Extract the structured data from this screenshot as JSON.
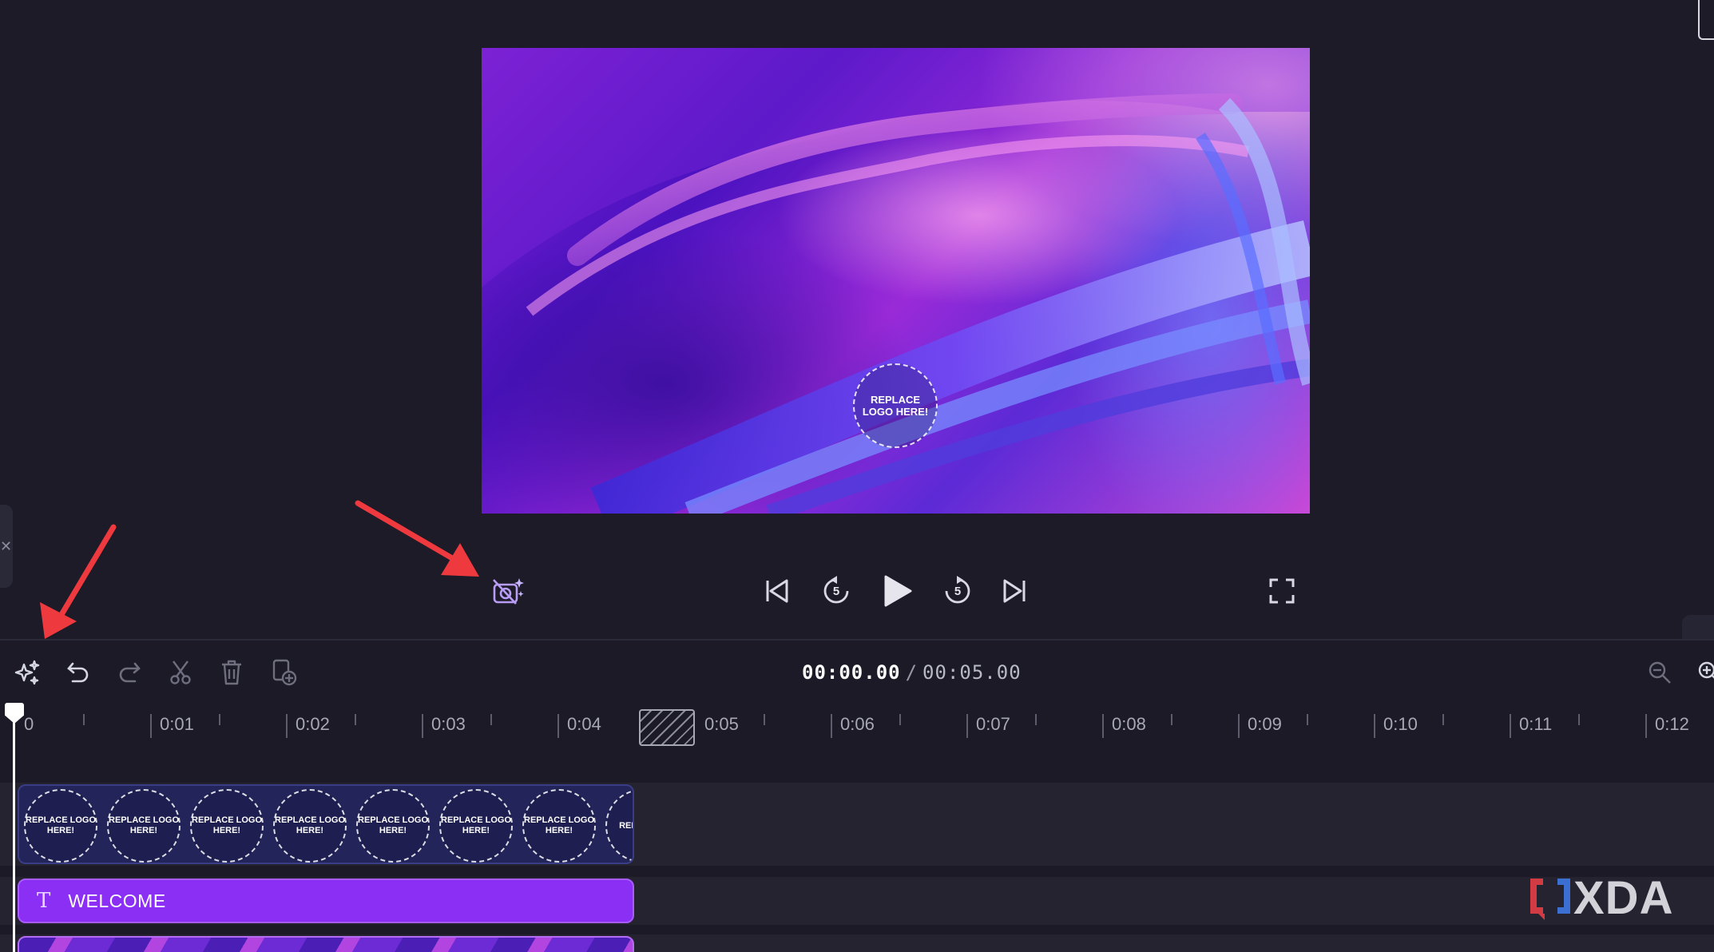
{
  "preview": {
    "logo_placeholder": "REPLACE LOGO HERE!",
    "side_tab_glyph": "✕"
  },
  "controls": {
    "ai_camera_icon": "camera-sparkle-icon",
    "skip_start_icon": "skip-to-start-icon",
    "rewind_icon": "rewind-5-icon",
    "rewind_seconds": "5",
    "play_icon": "play-icon",
    "forward_icon": "forward-5-icon",
    "forward_seconds": "5",
    "skip_end_icon": "skip-to-end-icon",
    "fullscreen_icon": "fullscreen-icon"
  },
  "toolbar": {
    "current_time": "00:00.00",
    "separator": "/",
    "duration": "00:05.00",
    "tools": [
      "magic-edit-icon",
      "undo-icon",
      "redo-icon",
      "cut-icon",
      "delete-icon",
      "duplicate-icon",
      "zoom-out-icon",
      "zoom-in-icon"
    ]
  },
  "ruler": {
    "labels": [
      "0",
      "0:01",
      "0:02",
      "0:03",
      "0:04",
      "0:05",
      "0:06",
      "0:07",
      "0:08",
      "0:09",
      "0:10",
      "0:11",
      "0:12"
    ]
  },
  "tracks": {
    "logo_track": {
      "thumb_text": "REPLACE LOGO HERE!",
      "partial_thumb_text": "REP LOGO"
    },
    "text_track": {
      "icon": "T",
      "label": "WELCOME"
    }
  },
  "watermark": {
    "brand": "XDA"
  },
  "colors": {
    "accent_purple": "#8b2ff5",
    "annotation_red": "#ee3a3f",
    "background": "#1b1a26"
  }
}
